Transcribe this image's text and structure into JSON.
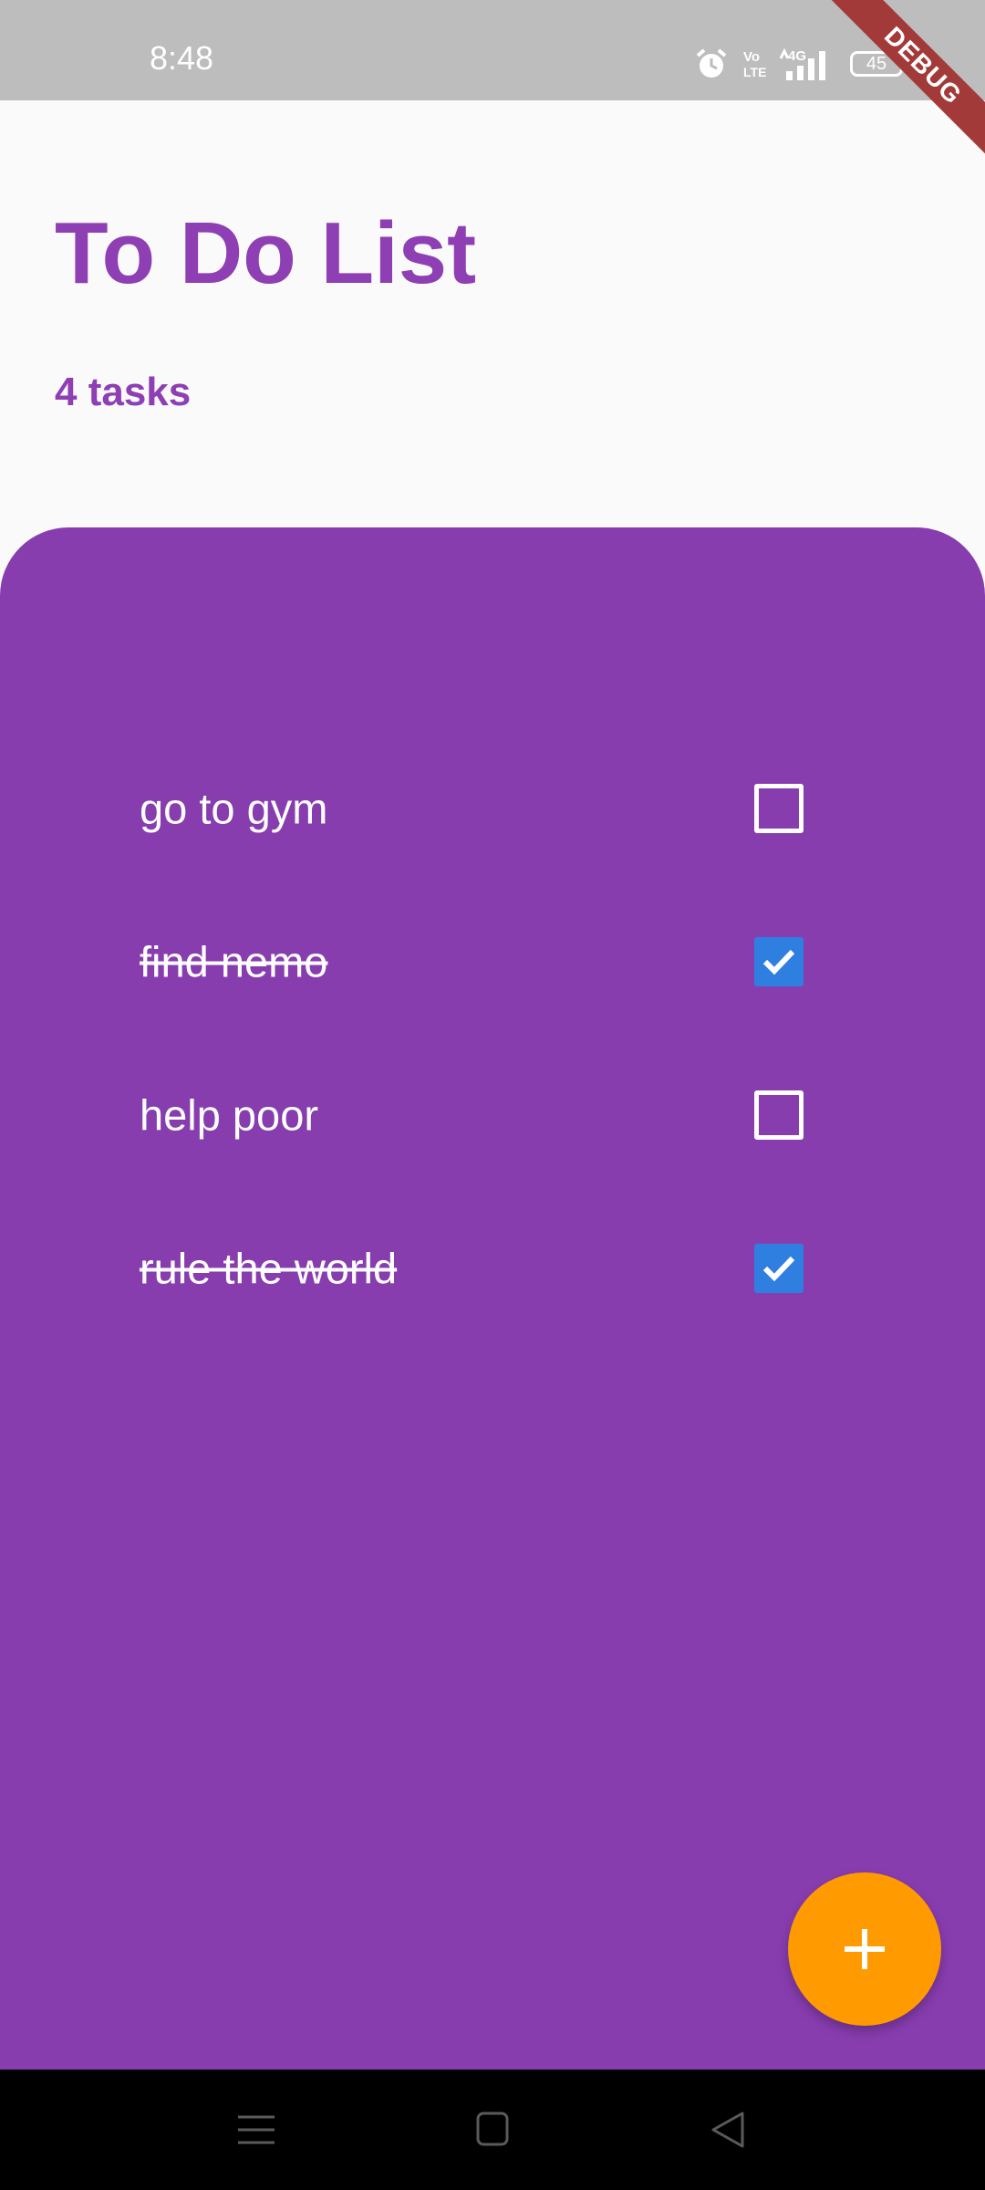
{
  "status_bar": {
    "time": "8:48",
    "battery": "45",
    "network_label": "4G",
    "volte_label_top": "Vo",
    "volte_label_bottom": "LTE",
    "debug_banner": "DEBUG"
  },
  "header": {
    "title": "To Do List",
    "task_count": "4 tasks"
  },
  "tasks": [
    {
      "text": "go to gym",
      "done": false
    },
    {
      "text": "find nemo",
      "done": true
    },
    {
      "text": "help poor",
      "done": false
    },
    {
      "text": "rule the world",
      "done": true
    }
  ],
  "fab": {
    "icon": "plus-icon"
  },
  "nav_bar": {
    "icons": [
      "menu-icon",
      "home-icon",
      "back-icon"
    ]
  },
  "colors": {
    "accent_purple": "#8e3fb3",
    "panel_purple": "#883daf",
    "checkbox_blue": "#2f7fe0",
    "fab_orange": "#ff9a00"
  }
}
